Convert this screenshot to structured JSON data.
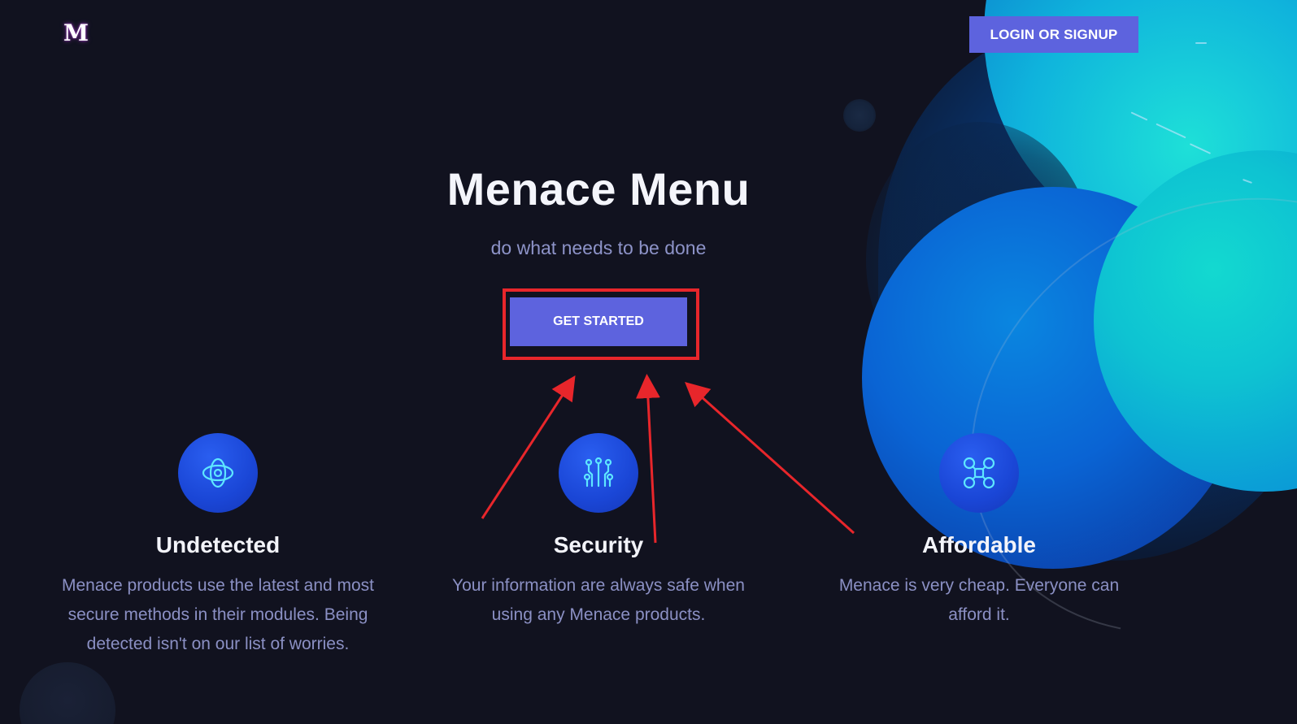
{
  "header": {
    "logo_text": "M",
    "login_label": "LOGIN OR SIGNUP"
  },
  "hero": {
    "title": "Menace Menu",
    "subtitle": "do what needs to be done",
    "cta_label": "GET STARTED"
  },
  "features": [
    {
      "icon": "orbit-icon",
      "title": "Undetected",
      "text": "Menace products use the latest and most secure methods in their modules. Being detected isn't on our list of worries."
    },
    {
      "icon": "circuit-icon",
      "title": "Security",
      "text": "Your information are always safe when using any Menace products."
    },
    {
      "icon": "drone-icon",
      "title": "Affordable",
      "text": "Menace is very cheap. Everyone can afford it."
    }
  ],
  "colors": {
    "background": "#11121f",
    "accent": "#5d63de",
    "annotation": "#e8262b",
    "icon_circle": "#1a46d6"
  }
}
